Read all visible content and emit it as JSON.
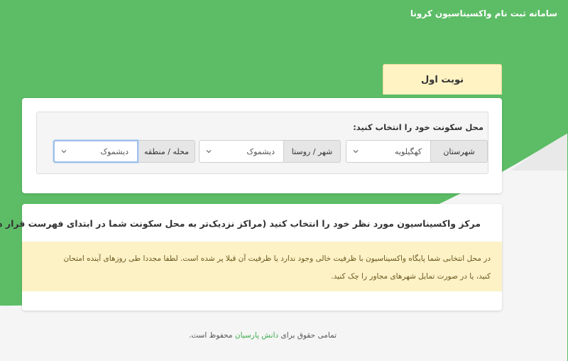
{
  "header": {
    "app_title": "سامانه ثبت نام واکسیناسیون کرونا"
  },
  "turn_tab": {
    "label": "نوبت اول"
  },
  "location": {
    "label": "محل سکونت خود را انتخاب کنید:",
    "fields": [
      {
        "prefix": "شهرستان",
        "value": "کهگیلویه"
      },
      {
        "prefix": "شهر / روستا",
        "value": "دیشموک"
      },
      {
        "prefix": "محله / منطقه",
        "value": "دیشموک"
      }
    ]
  },
  "center": {
    "title": "مرکز واکسیناسیون مورد نظر خود را انتخاب کنید (مراکز نزدیک‌تر به محل سکونت شما در ابتدای فهرست قرار دارند)",
    "alert_line1": "در محل انتخابی شما پایگاه واکسیناسیون با ظرفیت خالی وجود ندارد یا ظرفیت آن قبلا پر شده است. لطفا مجددا طی روزهای آینده امتحان",
    "alert_line2": "کنید، یا در صورت تمایل شهرهای مجاور را چک کنید."
  },
  "footer": {
    "text_before": "تمامی حقوق برای",
    "link": "دانش پارسیان",
    "text_after": "محفوظ است."
  },
  "colors": {
    "brand_green": "#5cbd66",
    "tab_yellow": "#fff3c4",
    "alert_yellow": "#fdf1c6",
    "link_green": "#3fae4f"
  }
}
